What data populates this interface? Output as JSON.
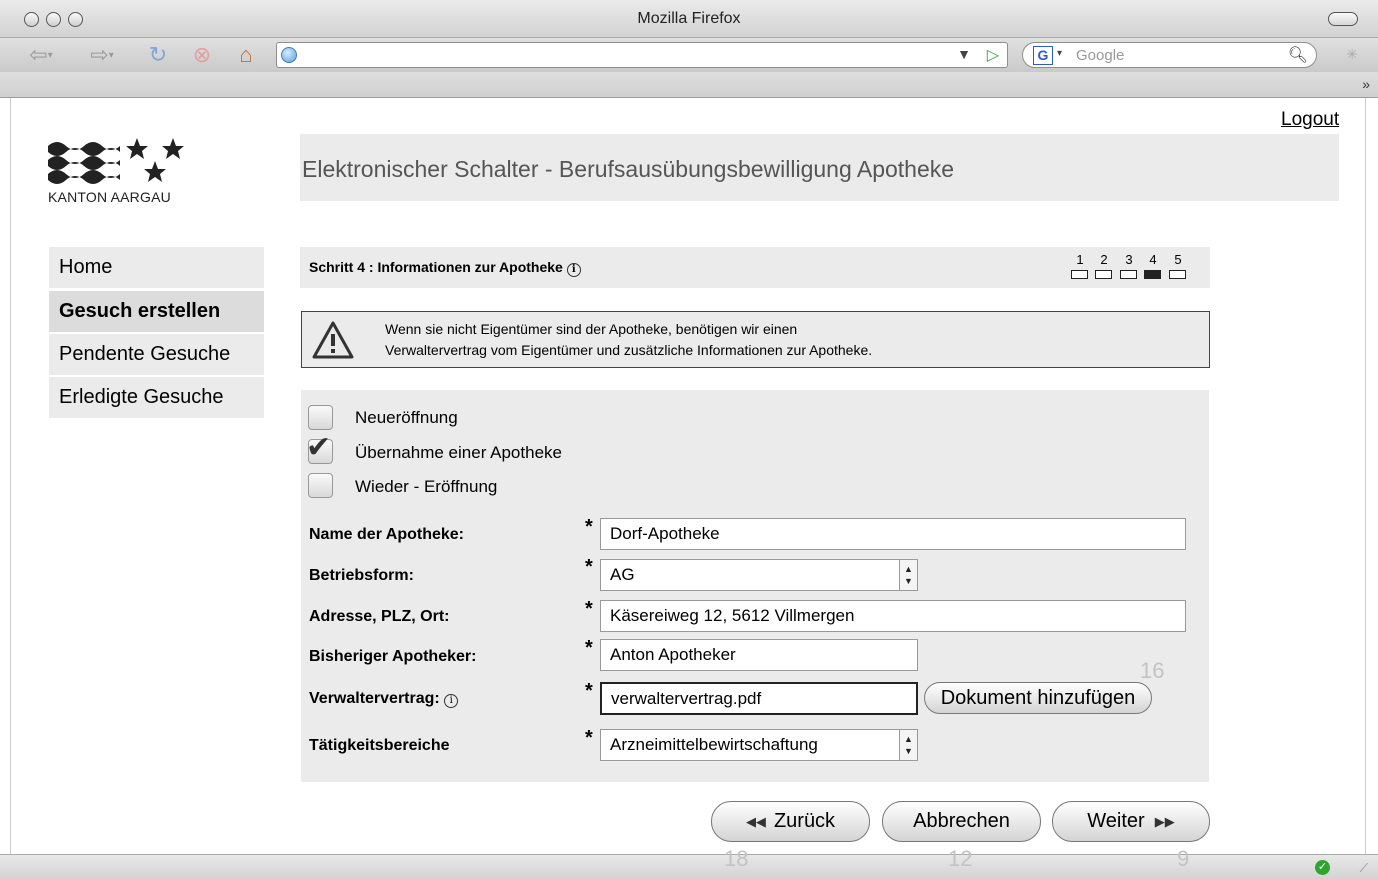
{
  "browser": {
    "title": "Mozilla Firefox",
    "url": "",
    "search_placeholder": "Google",
    "search_engine_letter": "G"
  },
  "header": {
    "logout": "Logout",
    "logo_text": "KANTON AARGAU",
    "title": "Elektronischer Schalter - Berufsausübungsbewilligung Apotheke"
  },
  "nav": {
    "items": [
      {
        "label": "Home"
      },
      {
        "label": "Gesuch erstellen"
      },
      {
        "label": "Pendente Gesuche"
      },
      {
        "label": "Erledigte Gesuche"
      }
    ]
  },
  "step": {
    "title": "Schritt 4 : Informationen zur Apotheke",
    "numbers": [
      "1",
      "2",
      "3",
      "4",
      "5"
    ],
    "current": 4
  },
  "warning": {
    "line1": "Wenn sie nicht Eigentümer sind der Apotheke, benötigen wir einen",
    "line2": "Verwaltervertrag vom Eigentümer und zusätzliche Informationen zur Apotheke."
  },
  "options": [
    {
      "label": "Neueröffnung",
      "checked": false
    },
    {
      "label": "Übernahme einer Apotheke",
      "checked": true
    },
    {
      "label": "Wieder - Eröffnung",
      "checked": false
    }
  ],
  "form": {
    "required_marker": "*",
    "name": {
      "label": "Name der Apotheke:",
      "value": "Dorf-Apotheke"
    },
    "betriebsform": {
      "label": "Betriebsform:",
      "value": "AG"
    },
    "adresse": {
      "label": "Adresse, PLZ, Ort:",
      "value": "Käsereiweg 12, 5612 Villmergen"
    },
    "apotheker": {
      "label": "Bisheriger Apotheker:",
      "value": "Anton Apotheker"
    },
    "vertrag": {
      "label": "Verwaltervertrag:",
      "value": "verwaltervertrag.pdf",
      "button": "Dokument hinzufügen"
    },
    "taetigkeit": {
      "label": "Tätigkeitsbereiche",
      "value": "Arzneimittelbewirtschaftung"
    }
  },
  "buttons": {
    "back": "Zurück",
    "cancel": "Abbrechen",
    "next": "Weiter"
  },
  "annotations": {
    "upload": "16",
    "back": "18",
    "cancel": "12",
    "next": "9"
  }
}
